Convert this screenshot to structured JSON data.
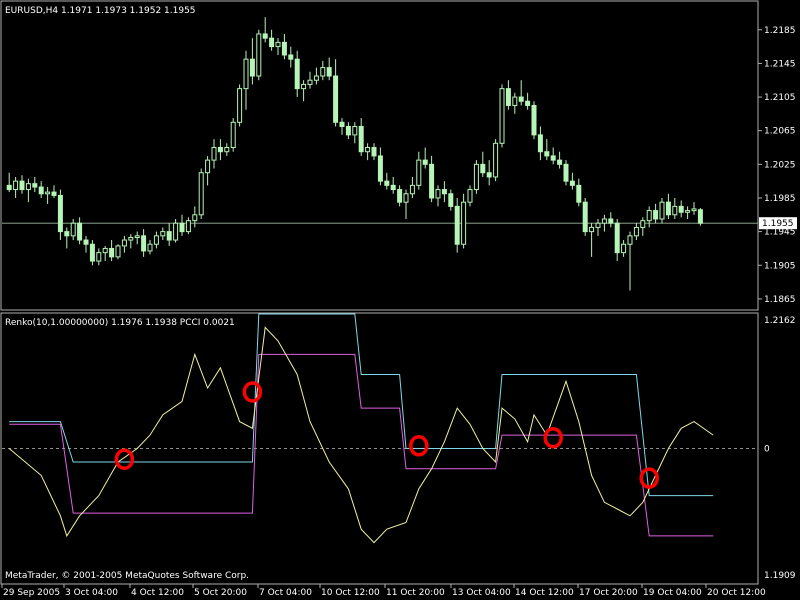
{
  "chart_data": [
    {
      "type": "candlestick",
      "header": "EURUSD,H4  1.1971 1.1973 1.1952 1.1955",
      "price_scale": [
        "1.2185",
        "1.2145",
        "1.2105",
        "1.2065",
        "1.2025",
        "1.1985",
        "1.1945",
        "1.1905",
        "1.1865"
      ],
      "ylim": [
        1.1853,
        1.2218
      ],
      "current_price": "1.1955",
      "candle_color": "#b7f4b7",
      "bar_count": 110,
      "candles": [
        [
          1.2,
          1.2015,
          1.1992,
          1.1995
        ],
        [
          1.1995,
          1.201,
          1.1985,
          1.2005
        ],
        [
          1.2005,
          1.2012,
          1.199,
          1.1995
        ],
        [
          1.1995,
          1.2008,
          1.198,
          1.2002
        ],
        [
          1.2002,
          1.201,
          1.1992,
          1.1998
        ],
        [
          1.1998,
          1.2005,
          1.1985,
          1.199
        ],
        [
          1.199,
          1.1998,
          1.1978,
          1.1992
        ],
        [
          1.1992,
          1.2,
          1.1985,
          1.1988
        ],
        [
          1.1988,
          1.1995,
          1.1935,
          1.1945
        ],
        [
          1.1945,
          1.195,
          1.1925,
          1.194
        ],
        [
          1.194,
          1.196,
          1.1935,
          1.1955
        ],
        [
          1.1955,
          1.1962,
          1.193,
          1.1935
        ],
        [
          1.1935,
          1.194,
          1.192,
          1.193
        ],
        [
          1.193,
          1.1935,
          1.1905,
          1.191
        ],
        [
          1.191,
          1.1925,
          1.1905,
          1.192
        ],
        [
          1.192,
          1.1928,
          1.191,
          1.1925
        ],
        [
          1.1925,
          1.1935,
          1.191,
          1.1915
        ],
        [
          1.1915,
          1.193,
          1.1912,
          1.1928
        ],
        [
          1.1928,
          1.194,
          1.192,
          1.1935
        ],
        [
          1.1935,
          1.1942,
          1.1925,
          1.1938
        ],
        [
          1.1938,
          1.1945,
          1.193,
          1.194
        ],
        [
          1.194,
          1.1948,
          1.1915,
          1.1922
        ],
        [
          1.1922,
          1.1935,
          1.1918,
          1.193
        ],
        [
          1.193,
          1.1945,
          1.1925,
          1.194
        ],
        [
          1.194,
          1.195,
          1.1935,
          1.1945
        ],
        [
          1.1945,
          1.1955,
          1.1928,
          1.1935
        ],
        [
          1.1935,
          1.196,
          1.1932,
          1.1955
        ],
        [
          1.1955,
          1.1965,
          1.194,
          1.1945
        ],
        [
          1.1945,
          1.1962,
          1.1942,
          1.1958
        ],
        [
          1.1958,
          1.1975,
          1.195,
          1.1965
        ],
        [
          1.1965,
          1.202,
          1.196,
          1.2015
        ],
        [
          1.2015,
          1.2035,
          1.2,
          1.203
        ],
        [
          1.203,
          1.2055,
          1.202,
          1.2045
        ],
        [
          1.2045,
          1.2055,
          1.203,
          1.204
        ],
        [
          1.204,
          1.205,
          1.2035,
          1.2045
        ],
        [
          1.2045,
          1.208,
          1.204,
          1.2075
        ],
        [
          1.2075,
          1.212,
          1.207,
          1.2115
        ],
        [
          1.2115,
          1.216,
          1.209,
          1.215
        ],
        [
          1.215,
          1.2175,
          1.212,
          1.213
        ],
        [
          1.213,
          1.2185,
          1.2125,
          1.218
        ],
        [
          1.218,
          1.22,
          1.217,
          1.2175
        ],
        [
          1.2175,
          1.2185,
          1.216,
          1.2165
        ],
        [
          1.2165,
          1.2175,
          1.2155,
          1.217
        ],
        [
          1.217,
          1.218,
          1.215,
          1.2155
        ],
        [
          1.2155,
          1.2165,
          1.214,
          1.215
        ],
        [
          1.215,
          1.216,
          1.2105,
          1.2115
        ],
        [
          1.2115,
          1.2125,
          1.21,
          1.212
        ],
        [
          1.212,
          1.2135,
          1.2115,
          1.2125
        ],
        [
          1.2125,
          1.214,
          1.212,
          1.213
        ],
        [
          1.213,
          1.2148,
          1.2125,
          1.214
        ],
        [
          1.214,
          1.2152,
          1.2125,
          1.213
        ],
        [
          1.213,
          1.215,
          1.207,
          1.2075
        ],
        [
          1.2075,
          1.208,
          1.206,
          1.207
        ],
        [
          1.207,
          1.2075,
          1.2055,
          1.206
        ],
        [
          1.206,
          1.2075,
          1.205,
          1.207
        ],
        [
          1.207,
          1.208,
          1.2035,
          1.204
        ],
        [
          1.204,
          1.205,
          1.203,
          1.2045
        ],
        [
          1.2045,
          1.205,
          1.203,
          1.2035
        ],
        [
          1.2035,
          1.2045,
          1.2,
          1.2005
        ],
        [
          1.2005,
          1.2015,
          1.1995,
          1.2
        ],
        [
          1.2,
          1.201,
          1.199,
          1.1995
        ],
        [
          1.1995,
          1.2,
          1.1975,
          1.198
        ],
        [
          1.198,
          1.1995,
          1.196,
          1.199
        ],
        [
          1.199,
          1.201,
          1.1985,
          1.2
        ],
        [
          1.2,
          1.204,
          1.1995,
          1.203
        ],
        [
          1.203,
          1.2045,
          1.202,
          1.2025
        ],
        [
          1.2025,
          1.2035,
          1.198,
          1.1985
        ],
        [
          1.1985,
          1.2,
          1.1975,
          1.1995
        ],
        [
          1.1995,
          1.2005,
          1.198,
          1.199
        ],
        [
          1.199,
          1.1995,
          1.197,
          1.1975
        ],
        [
          1.1975,
          1.1985,
          1.192,
          1.193
        ],
        [
          1.193,
          1.199,
          1.1925,
          1.198
        ],
        [
          1.198,
          1.2,
          1.1975,
          1.1995
        ],
        [
          1.1995,
          1.203,
          1.199,
          1.2025
        ],
        [
          1.2025,
          1.204,
          1.201,
          1.2015
        ],
        [
          1.2015,
          1.203,
          1.2,
          1.201
        ],
        [
          1.201,
          1.2055,
          1.2005,
          1.205
        ],
        [
          1.205,
          1.212,
          1.2045,
          1.2115
        ],
        [
          1.2115,
          1.2125,
          1.209,
          1.2095
        ],
        [
          1.2095,
          1.211,
          1.2085,
          1.2105
        ],
        [
          1.2105,
          1.2125,
          1.2095,
          1.21
        ],
        [
          1.21,
          1.211,
          1.209,
          1.2095
        ],
        [
          1.2095,
          1.21,
          1.2055,
          1.206
        ],
        [
          1.206,
          1.207,
          1.203,
          1.204
        ],
        [
          1.204,
          1.2055,
          1.203,
          1.2035
        ],
        [
          1.2035,
          1.2045,
          1.2025,
          1.203
        ],
        [
          1.203,
          1.204,
          1.202,
          1.2025
        ],
        [
          1.2025,
          1.203,
          1.2,
          1.2005
        ],
        [
          1.2005,
          1.2015,
          1.1995,
          1.2
        ],
        [
          1.2,
          1.2008,
          1.1975,
          1.198
        ],
        [
          1.198,
          1.1985,
          1.194,
          1.1945
        ],
        [
          1.1945,
          1.1955,
          1.1915,
          1.195
        ],
        [
          1.195,
          1.196,
          1.194,
          1.1955
        ],
        [
          1.1955,
          1.1965,
          1.1945,
          1.196
        ],
        [
          1.196,
          1.1968,
          1.195,
          1.1955
        ],
        [
          1.1955,
          1.196,
          1.191,
          1.192
        ],
        [
          1.192,
          1.1935,
          1.1915,
          1.193
        ],
        [
          1.193,
          1.1945,
          1.1875,
          1.194
        ],
        [
          1.194,
          1.1955,
          1.1935,
          1.195
        ],
        [
          1.195,
          1.1962,
          1.194,
          1.1958
        ],
        [
          1.1958,
          1.1975,
          1.195,
          1.197
        ],
        [
          1.197,
          1.1978,
          1.1955,
          1.196
        ],
        [
          1.196,
          1.1985,
          1.1955,
          1.198
        ],
        [
          1.198,
          1.199,
          1.196,
          1.1965
        ],
        [
          1.1965,
          1.1985,
          1.196,
          1.1975
        ],
        [
          1.1975,
          1.1982,
          1.1962,
          1.1968
        ],
        [
          1.1968,
          1.1975,
          1.196,
          1.197
        ],
        [
          1.197,
          1.198,
          1.1965,
          1.1972
        ],
        [
          1.1971,
          1.1973,
          1.1952,
          1.1955
        ]
      ]
    },
    {
      "type": "line",
      "header": "Renko(10,1.00000000) 1.1976 1.1938  PCCI 0.0021",
      "scale_labels": [
        "1.2162",
        "0",
        "1.1909"
      ],
      "ylim": [
        -1.0,
        1.0
      ],
      "zero_line": 0,
      "x_labels": [
        "29 Sep 2005",
        "3 Oct 04:00",
        "4 Oct 12:00",
        "5 Oct 20:00",
        "7 Oct 04:00",
        "10 Oct 12:00",
        "11 Oct 20:00",
        "13 Oct 04:00",
        "14 Oct 12:00",
        "17 Oct 20:00",
        "19 Oct 04:00",
        "20 Oct 12:00"
      ],
      "series": [
        {
          "color": "#7fd8e8",
          "points": [
            [
              0,
              0.2
            ],
            [
              8,
              0.2
            ],
            [
              10,
              -0.1
            ],
            [
              38,
              -0.1
            ],
            [
              39,
              1.0
            ],
            [
              54,
              1.0
            ],
            [
              55,
              0.55
            ],
            [
              61,
              0.55
            ],
            [
              62,
              0.0
            ],
            [
              76,
              0.0
            ],
            [
              77,
              0.55
            ],
            [
              98,
              0.55
            ],
            [
              100,
              -0.35
            ],
            [
              110,
              -0.35
            ]
          ]
        },
        {
          "color": "#e060e0",
          "points": [
            [
              0,
              0.18
            ],
            [
              8,
              0.18
            ],
            [
              10,
              -0.48
            ],
            [
              38,
              -0.48
            ],
            [
              39,
              0.7
            ],
            [
              54,
              0.7
            ],
            [
              55,
              0.3
            ],
            [
              61,
              0.3
            ],
            [
              62,
              -0.15
            ],
            [
              76,
              -0.15
            ],
            [
              77,
              0.1
            ],
            [
              98,
              0.1
            ],
            [
              100,
              -0.65
            ],
            [
              110,
              -0.65
            ]
          ]
        },
        {
          "color": "#f0f0a0",
          "points": [
            [
              0,
              0.0
            ],
            [
              5,
              -0.2
            ],
            [
              8,
              -0.5
            ],
            [
              9,
              -0.65
            ],
            [
              11,
              -0.5
            ],
            [
              14,
              -0.35
            ],
            [
              17,
              -0.1
            ],
            [
              20,
              0.0
            ],
            [
              22,
              0.1
            ],
            [
              24,
              0.25
            ],
            [
              27,
              0.35
            ],
            [
              29,
              0.7
            ],
            [
              31,
              0.45
            ],
            [
              33,
              0.6
            ],
            [
              36,
              0.2
            ],
            [
              38,
              0.15
            ],
            [
              40,
              0.9
            ],
            [
              42,
              0.8
            ],
            [
              45,
              0.55
            ],
            [
              47,
              0.2
            ],
            [
              50,
              -0.1
            ],
            [
              53,
              -0.3
            ],
            [
              55,
              -0.6
            ],
            [
              57,
              -0.7
            ],
            [
              59,
              -0.6
            ],
            [
              62,
              -0.55
            ],
            [
              64,
              -0.3
            ],
            [
              66,
              -0.15
            ],
            [
              68,
              0.05
            ],
            [
              70,
              0.3
            ],
            [
              72,
              0.18
            ],
            [
              74,
              0.0
            ],
            [
              76,
              -0.1
            ],
            [
              77,
              0.3
            ],
            [
              79,
              0.22
            ],
            [
              81,
              0.05
            ],
            [
              82,
              0.25
            ],
            [
              84,
              0.1
            ],
            [
              87,
              0.5
            ],
            [
              89,
              0.2
            ],
            [
              91,
              -0.2
            ],
            [
              93,
              -0.4
            ],
            [
              95,
              -0.45
            ],
            [
              97,
              -0.5
            ],
            [
              99,
              -0.4
            ],
            [
              101,
              -0.2
            ],
            [
              103,
              0.0
            ],
            [
              105,
              0.15
            ],
            [
              107,
              0.2
            ],
            [
              110,
              0.1
            ]
          ]
        }
      ],
      "markers": [
        {
          "x": 18,
          "y": -0.08
        },
        {
          "x": 38,
          "y": 0.42
        },
        {
          "x": 64,
          "y": 0.02
        },
        {
          "x": 85,
          "y": 0.08
        },
        {
          "x": 100,
          "y": -0.22
        }
      ],
      "marker_color": "#ff0000"
    }
  ],
  "footer": {
    "copyright": "MetaTrader, © 2001-2005 MetaQuotes Software Corp."
  }
}
